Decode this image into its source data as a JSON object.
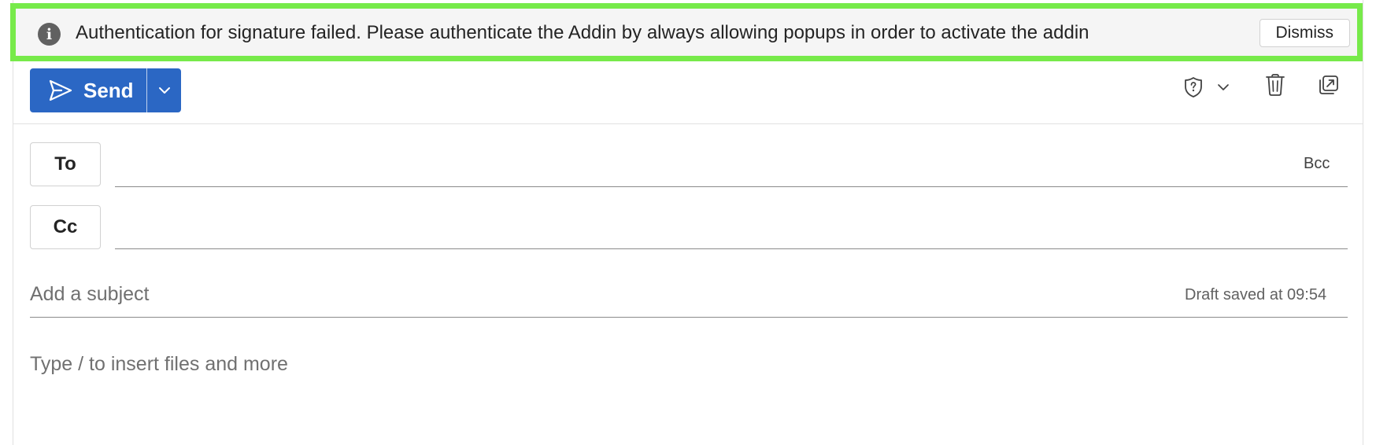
{
  "banner": {
    "icon": "info-icon",
    "icon_glyph": "i",
    "message": "Authentication for signature failed. Please authenticate the Addin by always allowing popups in order to activate the addin",
    "dismiss_label": "Dismiss",
    "highlight_color": "#77ea4a"
  },
  "toolbar": {
    "send_label": "Send",
    "send_icon": "send-icon",
    "dropdown_icon": "chevron-down-icon",
    "sensitivity_icon": "shield-question-icon",
    "sensitivity_dropdown_icon": "chevron-down-icon",
    "discard_icon": "trash-icon",
    "popout_icon": "pop-out-icon",
    "accent_color": "#2b67c4"
  },
  "recipients": {
    "to_label": "To",
    "cc_label": "Cc",
    "bcc_label": "Bcc",
    "to_value": "",
    "cc_value": ""
  },
  "subject": {
    "placeholder": "Add a subject",
    "value": "",
    "draft_status": "Draft saved at 09:54"
  },
  "body": {
    "placeholder": "Type / to insert files and more"
  }
}
